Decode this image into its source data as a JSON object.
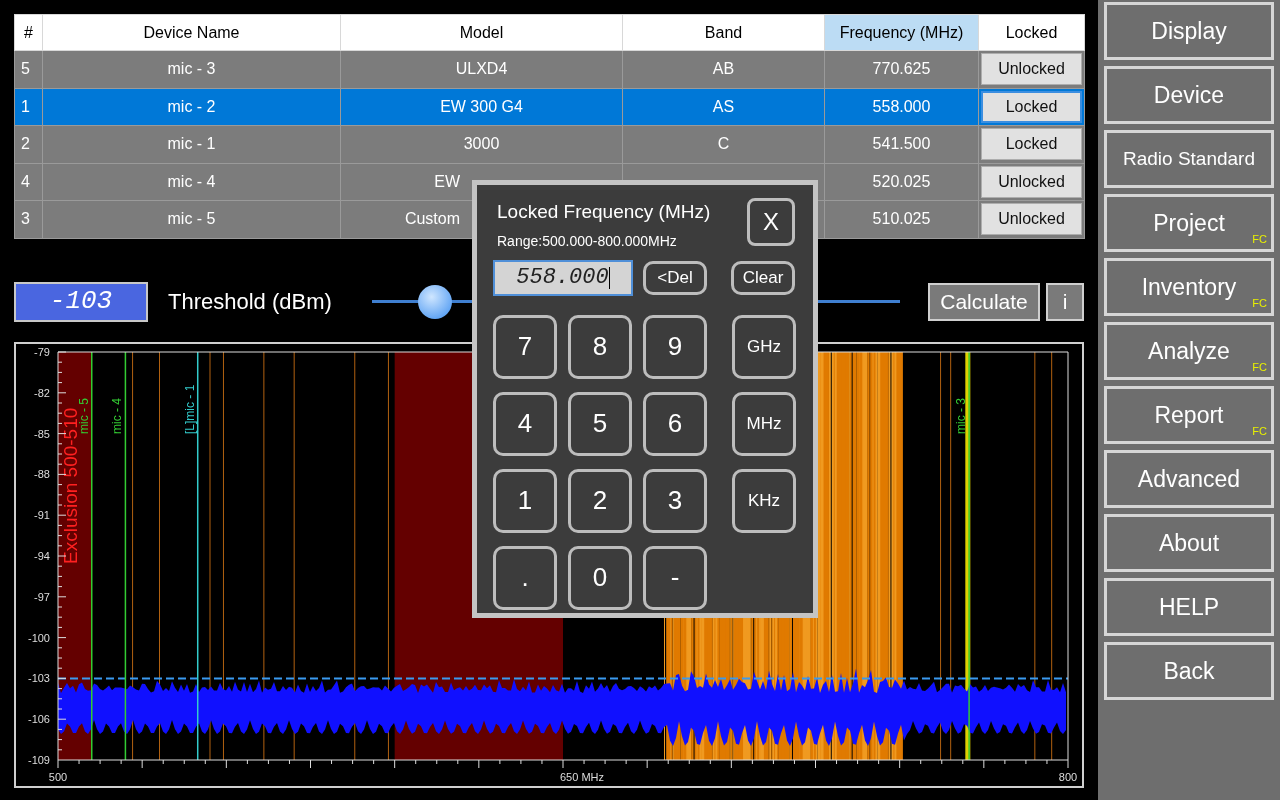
{
  "table": {
    "columns": [
      {
        "label": "#",
        "selected": false
      },
      {
        "label": "Device Name",
        "selected": false
      },
      {
        "label": "Model",
        "selected": false
      },
      {
        "label": "Band",
        "selected": false
      },
      {
        "label": "Frequency (MHz)",
        "selected": true
      },
      {
        "label": "Locked",
        "selected": false
      }
    ],
    "rows": [
      {
        "num": "5",
        "name": "mic - 3",
        "model": "ULXD4",
        "band": "AB",
        "freq": "770.625",
        "locked": "Unlocked",
        "selected": false
      },
      {
        "num": "1",
        "name": "mic - 2",
        "model": "EW 300 G4",
        "band": "AS",
        "freq": "558.000",
        "locked": "Locked",
        "selected": true
      },
      {
        "num": "2",
        "name": "mic - 1",
        "model": "3000",
        "band": "C",
        "freq": "541.500",
        "locked": "Locked",
        "selected": false
      },
      {
        "num": "4",
        "name": "mic - 4",
        "model": "EW",
        "freq": "520.025",
        "locked": "Unlocked",
        "selected": false
      },
      {
        "num": "3",
        "name": "mic - 5",
        "model": "Custom",
        "freq": "510.025",
        "locked": "Unlocked",
        "selected": false
      }
    ]
  },
  "threshold": {
    "value": "-103",
    "label": "Threshold (dBm)",
    "level": 0.12
  },
  "calculate_button": "Calculate",
  "info_button": "i",
  "spectrum": {
    "yticks": [
      "-79",
      "-82",
      "-85",
      "-88",
      "-91",
      "-94",
      "-97",
      "-100",
      "-103",
      "-106",
      "-109"
    ],
    "xlabels": [
      "500",
      "650 MHz",
      "800"
    ],
    "exclusion_label": "Exclusion 500-510",
    "markers": [
      {
        "label": "mic - 5",
        "color": "#33cc33"
      },
      {
        "label": "mic - 4",
        "color": "#33cc33"
      },
      {
        "label": "[L]mic - 1",
        "color": "#33cccc"
      },
      {
        "label": "mic - 3",
        "color": "#33cc33"
      }
    ]
  },
  "dialog": {
    "title": "Locked Frequency (MHz)",
    "range": "Range:500.000-800.000MHz",
    "close": "X",
    "value": "558.000",
    "del": "<Del",
    "clear": "Clear",
    "keys": [
      "7",
      "8",
      "9",
      "GHz",
      "4",
      "5",
      "6",
      "MHz",
      "1",
      "2",
      "3",
      "KHz",
      ".",
      "0",
      "-"
    ]
  },
  "sidebar": [
    {
      "label": "Display"
    },
    {
      "label": "Device"
    },
    {
      "label": "Radio Standard"
    },
    {
      "label": "Project",
      "badge": "FC"
    },
    {
      "label": "Inventory",
      "badge": "FC"
    },
    {
      "label": "Analyze",
      "badge": "FC"
    },
    {
      "label": "Report",
      "badge": "FC"
    },
    {
      "label": "Advanced"
    },
    {
      "label": "About"
    },
    {
      "label": "HELP"
    },
    {
      "label": "Back"
    }
  ]
}
